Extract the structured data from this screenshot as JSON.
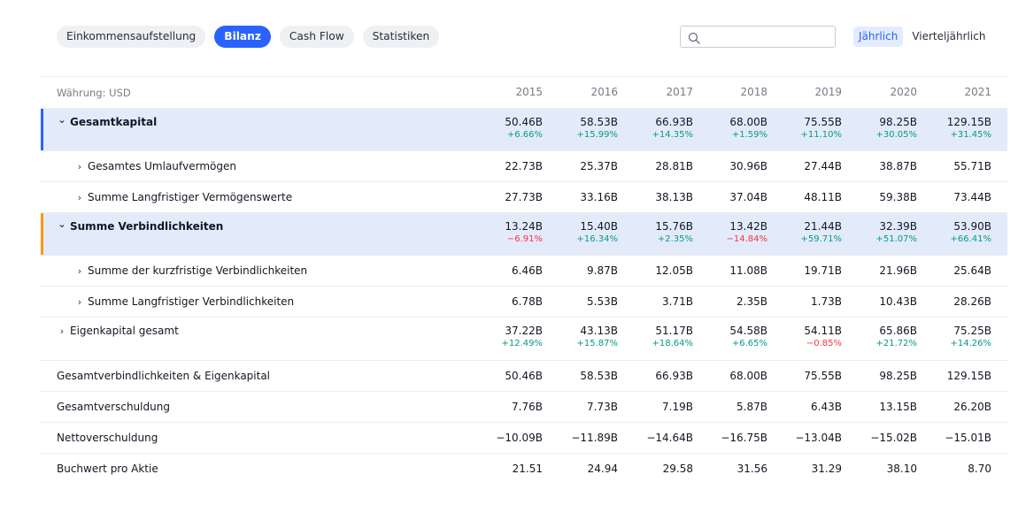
{
  "tabs": [
    {
      "label": "Einkommensaufstellung",
      "active": false
    },
    {
      "label": "Bilanz",
      "active": true
    },
    {
      "label": "Cash Flow",
      "active": false
    },
    {
      "label": "Statistiken",
      "active": false
    }
  ],
  "search": {
    "placeholder": "",
    "value": ""
  },
  "period": {
    "annual": "Jährlich",
    "quarterly": "Vierteljährlich",
    "selected": "annual"
  },
  "colors": {
    "accent": "#2962ff",
    "positive": "#089981",
    "negative": "#f23645",
    "assets_bar": "#2962ff",
    "liabilities_bar": "#ff9800",
    "group_bg": "#e3ebfb"
  },
  "table": {
    "currency_label": "Währung: USD",
    "years": [
      "2015",
      "2016",
      "2017",
      "2018",
      "2019",
      "2020",
      "2021"
    ],
    "rows": [
      {
        "label": "Gesamtkapital",
        "kind": "group",
        "chevron": "down",
        "accent": "blue",
        "values": [
          "50.46B",
          "58.53B",
          "66.93B",
          "68.00B",
          "75.55B",
          "98.25B",
          "129.15B"
        ],
        "changes": [
          "+6.66%",
          "+15.99%",
          "+14.35%",
          "+1.59%",
          "+11.10%",
          "+30.05%",
          "+31.45%"
        ]
      },
      {
        "label": "Gesamtes Umlaufvermögen",
        "kind": "child",
        "chevron": "right",
        "values": [
          "22.73B",
          "25.37B",
          "28.81B",
          "30.96B",
          "27.44B",
          "38.87B",
          "55.71B"
        ]
      },
      {
        "label": "Summe Langfristiger Vermögenswerte",
        "kind": "child",
        "chevron": "right",
        "values": [
          "27.73B",
          "33.16B",
          "38.13B",
          "37.04B",
          "48.11B",
          "59.38B",
          "73.44B"
        ]
      },
      {
        "label": "Summe Verbindlichkeiten",
        "kind": "group",
        "chevron": "down",
        "accent": "orange",
        "values": [
          "13.24B",
          "15.40B",
          "15.76B",
          "13.42B",
          "21.44B",
          "32.39B",
          "53.90B"
        ],
        "changes": [
          "−6.91%",
          "+16.34%",
          "+2.35%",
          "−14.84%",
          "+59.71%",
          "+51.07%",
          "+66.41%"
        ]
      },
      {
        "label": "Summe der kurzfristige Verbindlichkeiten",
        "kind": "child",
        "chevron": "right",
        "values": [
          "6.46B",
          "9.87B",
          "12.05B",
          "11.08B",
          "19.71B",
          "21.96B",
          "25.64B"
        ]
      },
      {
        "label": "Summe Langfristiger Verbindlichkeiten",
        "kind": "child",
        "chevron": "right",
        "values": [
          "6.78B",
          "5.53B",
          "3.71B",
          "2.35B",
          "1.73B",
          "10.43B",
          "28.26B"
        ]
      },
      {
        "label": "Eigenkapital gesamt",
        "kind": "top",
        "chevron": "right",
        "values": [
          "37.22B",
          "43.13B",
          "51.17B",
          "54.58B",
          "54.11B",
          "65.86B",
          "75.25B"
        ],
        "changes": [
          "+12.49%",
          "+15.87%",
          "+18.64%",
          "+6.65%",
          "−0.85%",
          "+21.72%",
          "+14.26%"
        ]
      },
      {
        "label": "Gesamtverbindlichkeiten & Eigenkapital",
        "kind": "plain",
        "values": [
          "50.46B",
          "58.53B",
          "66.93B",
          "68.00B",
          "75.55B",
          "98.25B",
          "129.15B"
        ]
      },
      {
        "label": "Gesamtverschuldung",
        "kind": "plain",
        "values": [
          "7.76B",
          "7.73B",
          "7.19B",
          "5.87B",
          "6.43B",
          "13.15B",
          "26.20B"
        ]
      },
      {
        "label": "Nettoverschuldung",
        "kind": "plain",
        "values": [
          "−10.09B",
          "−11.89B",
          "−14.64B",
          "−16.75B",
          "−13.04B",
          "−15.02B",
          "−15.01B"
        ]
      },
      {
        "label": "Buchwert pro Aktie",
        "kind": "plain",
        "values": [
          "21.51",
          "24.94",
          "29.58",
          "31.56",
          "31.29",
          "38.10",
          "8.70"
        ]
      }
    ]
  }
}
